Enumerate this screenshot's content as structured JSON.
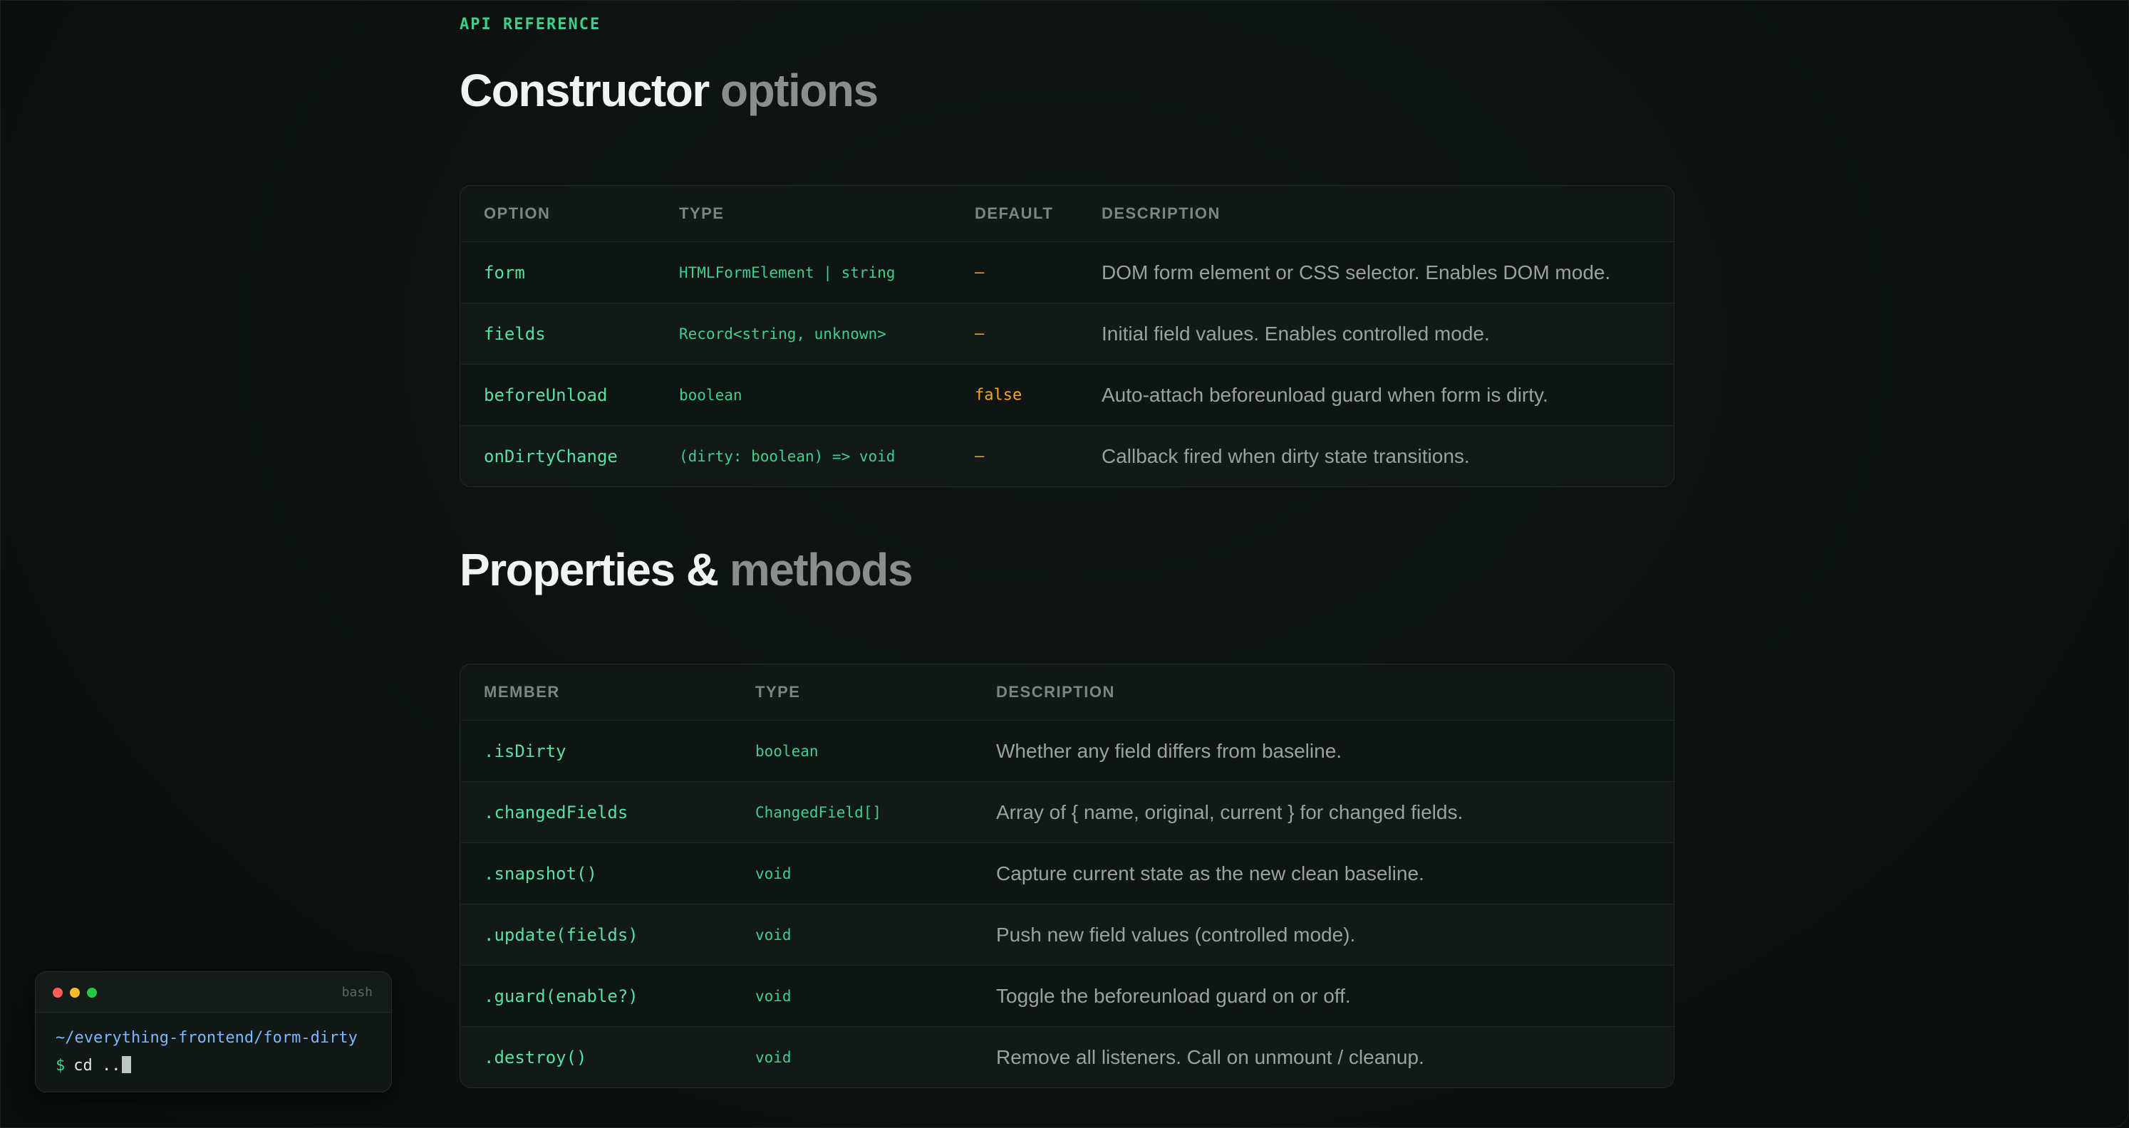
{
  "eyebrow": "API REFERENCE",
  "section_constructor": {
    "title_main": "Constructor",
    "title_muted": "options",
    "columns": {
      "option": "OPTION",
      "type": "TYPE",
      "default": "DEFAULT",
      "description": "DESCRIPTION"
    },
    "rows": [
      {
        "option": "form",
        "type": "HTMLFormElement | string",
        "default": "—",
        "description": "DOM form element or CSS selector. Enables DOM mode."
      },
      {
        "option": "fields",
        "type": "Record<string, unknown>",
        "default": "—",
        "description": "Initial field values. Enables controlled mode."
      },
      {
        "option": "beforeUnload",
        "type": "boolean",
        "default": "false",
        "description": "Auto-attach beforeunload guard when form is dirty."
      },
      {
        "option": "onDirtyChange",
        "type": "(dirty: boolean) => void",
        "default": "—",
        "description": "Callback fired when dirty state transitions."
      }
    ]
  },
  "section_properties": {
    "title_main": "Properties &",
    "title_muted": "methods",
    "columns": {
      "member": "MEMBER",
      "type": "TYPE",
      "description": "DESCRIPTION"
    },
    "rows": [
      {
        "member": ".isDirty",
        "type": "boolean",
        "description": "Whether any field differs from baseline."
      },
      {
        "member": ".changedFields",
        "type": "ChangedField[]",
        "description": "Array of { name, original, current } for changed fields."
      },
      {
        "member": ".snapshot()",
        "type": "void",
        "description": "Capture current state as the new clean baseline."
      },
      {
        "member": ".update(fields)",
        "type": "void",
        "description": "Push new field values (controlled mode)."
      },
      {
        "member": ".guard(enable?)",
        "type": "void",
        "description": "Toggle the beforeunload guard on or off."
      },
      {
        "member": ".destroy()",
        "type": "void",
        "description": "Remove all listeners. Call on unmount / cleanup."
      }
    ]
  },
  "terminal": {
    "label": "bash",
    "path": "~/everything-frontend/form-dirty",
    "prompt": "$",
    "command": "cd .."
  },
  "colors": {
    "accent": "#3ecf8e",
    "default_value": "#f5a524",
    "path": "#7cb7ff"
  }
}
